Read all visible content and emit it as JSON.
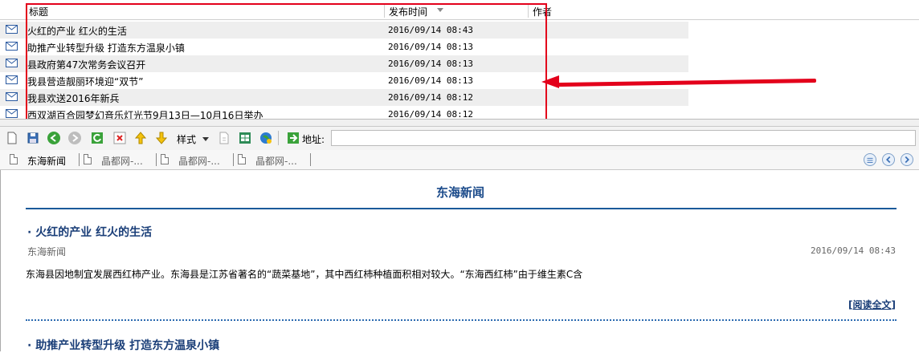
{
  "list": {
    "columns": [
      "标题",
      "发布时间",
      "作者"
    ],
    "rows": [
      {
        "title": "火红的产业 红火的生活",
        "date": "2016/09/14 08:43"
      },
      {
        "title": "助推产业转型升级 打造东方温泉小镇",
        "date": "2016/09/14 08:13"
      },
      {
        "title": "县政府第47次常务会议召开",
        "date": "2016/09/14 08:13"
      },
      {
        "title": "我县营造靓丽环境迎“双节”",
        "date": "2016/09/14 08:13"
      },
      {
        "title": "我县欢送2016年新兵",
        "date": "2016/09/14 08:12"
      },
      {
        "title": "西双湖百合园梦幻音乐灯光节9月13日—10月16日举办",
        "date": "2016/09/14 08:12"
      }
    ]
  },
  "toolbar": {
    "style_label": "样式",
    "address_label": "地址:",
    "address_value": ""
  },
  "tabs": [
    {
      "label": "东海新闻",
      "active": true
    },
    {
      "label": "晶都网-...",
      "active": false
    },
    {
      "label": "晶都网-...",
      "active": false
    },
    {
      "label": "晶都网-...",
      "active": false
    }
  ],
  "content": {
    "page_title": "东海新闻",
    "articles": [
      {
        "title": "· 火红的产业 红火的生活",
        "source": "东海新闻",
        "date": "2016/09/14 08:43",
        "summary": "东海县因地制宜发展西红柿产业。东海县是江苏省著名的“蔬菜基地”，其中西红柿种植面积相对较大。“东海西红柿”由于维生素C含",
        "read_more": "阅读全文"
      },
      {
        "title": "· 助推产业转型升级 打造东方温泉小镇"
      }
    ]
  },
  "colors": {
    "highlight": "#e3001b",
    "title_blue": "#1a4a8a",
    "row_shade": "#eeeeee"
  }
}
